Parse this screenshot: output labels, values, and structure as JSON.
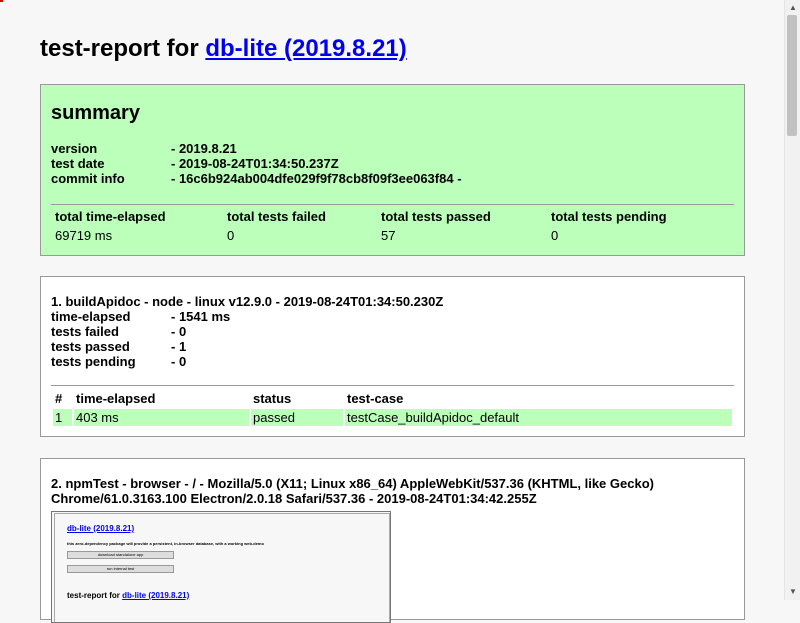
{
  "page": {
    "title_prefix": "test-report for ",
    "title_link": "db-lite (2019.8.21)"
  },
  "summary": {
    "heading": "summary",
    "fields": [
      {
        "label": "version",
        "value": "- 2019.8.21"
      },
      {
        "label": "test date",
        "value": "- 2019-08-24T01:34:50.237Z"
      },
      {
        "label": "commit info",
        "value": "- 16c6b924ab004dfe029f9f78cb8f09f3ee063f84 -"
      }
    ],
    "table": {
      "headers": [
        "total time-elapsed",
        "total tests failed",
        "total tests passed",
        "total tests pending"
      ],
      "values": [
        "69719 ms",
        "0",
        "57",
        "0"
      ]
    }
  },
  "test1": {
    "title": "1. buildApidoc - node - linux v12.9.0 - 2019-08-24T01:34:50.230Z",
    "fields": [
      {
        "label": "time-elapsed",
        "value": "- 1541 ms"
      },
      {
        "label": "tests failed",
        "value": "- 0"
      },
      {
        "label": "tests passed",
        "value": "- 1"
      },
      {
        "label": "tests pending",
        "value": "- 0"
      }
    ],
    "table": {
      "headers": [
        "#",
        "time-elapsed",
        "status",
        "test-case"
      ],
      "rows": [
        [
          "1",
          "403 ms",
          "passed",
          "testCase_buildApidoc_default"
        ]
      ]
    }
  },
  "test2": {
    "title": "2. npmTest - browser - / - Mozilla/5.0 (X11; Linux x86_64) AppleWebKit/537.36 (KHTML, like Gecko) Chrome/61.0.3163.100 Electron/2.0.18 Safari/537.36 - 2019-08-24T01:34:42.255Z",
    "screenshot": {
      "link": "db-lite (2019.8.21)",
      "description": "this zero-dependency package will provide a persistent, in-browser database, with a working web-demo",
      "button1": "download standalone app",
      "button2": "run internal test",
      "report_prefix": "test-report for ",
      "report_link": "db-lite (2019.8.21)"
    }
  },
  "colors": {
    "passed_bg": "#bbffbb",
    "link": "#0000ee"
  }
}
